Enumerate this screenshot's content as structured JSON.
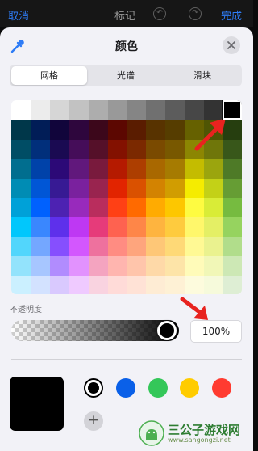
{
  "navbar": {
    "cancel": "取消",
    "title": "标记",
    "done": "完成"
  },
  "panel": {
    "title": "颜色",
    "tabs": [
      "网格",
      "光谱",
      "滑块"
    ],
    "active_tab_index": 0
  },
  "grid": {
    "rows": [
      [
        "#ffffff",
        "#ececec",
        "#d6d6d6",
        "#c2c2c2",
        "#adadad",
        "#999999",
        "#858585",
        "#707070",
        "#5c5c5c",
        "#474747",
        "#333333",
        "#000000"
      ],
      [
        "#00374a",
        "#011d57",
        "#11053b",
        "#2e063d",
        "#3c071b",
        "#5c0701",
        "#5a1c00",
        "#583300",
        "#563d00",
        "#666100",
        "#4f5504",
        "#263e0f"
      ],
      [
        "#004d65",
        "#012f7b",
        "#1a0a52",
        "#450d59",
        "#551029",
        "#831100",
        "#7b2900",
        "#7a4a00",
        "#785800",
        "#8c8602",
        "#6f760a",
        "#38571a"
      ],
      [
        "#016e8f",
        "#0042a9",
        "#2c0977",
        "#61187c",
        "#791a3d",
        "#b51a00",
        "#ad3e00",
        "#a96800",
        "#a67b01",
        "#c4bc00",
        "#9ba50e",
        "#4e7a27"
      ],
      [
        "#008cb4",
        "#0056d6",
        "#371a94",
        "#7a219e",
        "#99244f",
        "#e22400",
        "#da5100",
        "#d38301",
        "#d19d01",
        "#f5ec00",
        "#c3d117",
        "#669d34"
      ],
      [
        "#00a1d8",
        "#0061fe",
        "#4d22b2",
        "#982abc",
        "#b92d5d",
        "#ff4015",
        "#ff6a00",
        "#ffab01",
        "#fdc700",
        "#fefb41",
        "#d9ec37",
        "#76bb40"
      ],
      [
        "#01c7fc",
        "#3a87fe",
        "#5e30eb",
        "#be38f3",
        "#e63b7a",
        "#fe6250",
        "#fe8648",
        "#feb43f",
        "#fecb3e",
        "#fff76b",
        "#e4ef65",
        "#96d35f"
      ],
      [
        "#52d6fc",
        "#74a7ff",
        "#864ffe",
        "#d357fe",
        "#ee719e",
        "#ff8c82",
        "#fea57d",
        "#fec777",
        "#fed977",
        "#fff994",
        "#eaf28f",
        "#b1dd8b"
      ],
      [
        "#93e3fc",
        "#a7c6ff",
        "#b18cfe",
        "#e292fe",
        "#f4a4c0",
        "#ffb5af",
        "#ffc5ab",
        "#fed9a8",
        "#fde4a8",
        "#fffbb9",
        "#f1f7b7",
        "#cde8b5"
      ],
      [
        "#cbf0ff",
        "#d3e2ff",
        "#d9c9fe",
        "#efcaff",
        "#f9d3e0",
        "#ffdbd8",
        "#ffe2d6",
        "#feecd4",
        "#fef1d5",
        "#fdfbdd",
        "#f6fadb",
        "#deeed4"
      ]
    ],
    "selected": "#000000"
  },
  "opacity": {
    "label": "不透明度",
    "value_text": "100%",
    "value": 1.0
  },
  "current_color": "#000000",
  "favorites": [
    {
      "name": "black",
      "color": "#000000"
    },
    {
      "name": "blue",
      "color": "#0a60e8"
    },
    {
      "name": "green",
      "color": "#34c759"
    },
    {
      "name": "yellow",
      "color": "#ffcc00"
    },
    {
      "name": "red",
      "color": "#ff3b30"
    }
  ],
  "accent": "#2e7cf6",
  "watermark": {
    "name": "三公子游戏网",
    "url": "www.sangongzi.net"
  }
}
